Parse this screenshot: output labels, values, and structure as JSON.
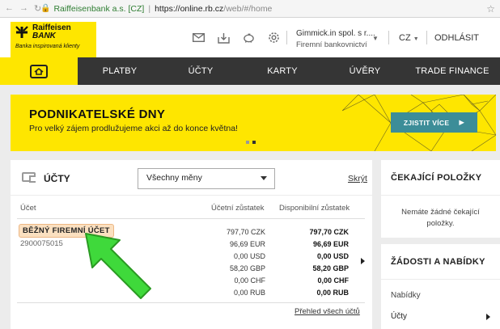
{
  "browser": {
    "site_identity": "Raiffeisenbank a.s. [CZ]",
    "url_host": "https://online.rb.cz",
    "url_path": "/web/#/home"
  },
  "header": {
    "logo_name_line1": "Raiffeisen",
    "logo_name_line2": "BANK",
    "logo_tagline": "Banka inspirovaná klienty",
    "company_name": "Gimmick.in spol. s r....",
    "company_type": "Firemní bankovnictví",
    "language": "CZ",
    "logout": "ODHLÁSIT"
  },
  "nav": {
    "items": [
      "PLATBY",
      "ÚČTY",
      "KARTY",
      "ÚVĚRY",
      "TRADE FINANCE"
    ]
  },
  "banner": {
    "title": "PODNIKATELSKÉ DNY",
    "text": "Pro velký zájem prodlužujeme akci až do konce května!",
    "button": "ZJISTIT VÍCE"
  },
  "accounts": {
    "title": "ÚČTY",
    "currency_filter": "Všechny měny",
    "hide_link": "Skrýt",
    "columns": {
      "account": "Účet",
      "book_balance": "Účetní zůstatek",
      "available_balance": "Disponibilní zůstatek"
    },
    "account": {
      "name": "BĚŽNÝ FIREMNÍ ÚČET",
      "number": "2900075015"
    },
    "balances": [
      {
        "book": "797,70 CZK",
        "available": "797,70 CZK"
      },
      {
        "book": "96,69 EUR",
        "available": "96,69 EUR"
      },
      {
        "book": "0,00 USD",
        "available": "0,00 USD"
      },
      {
        "book": "58,20 GBP",
        "available": "58,20 GBP"
      },
      {
        "book": "0,00 CHF",
        "available": "0,00 CHF"
      },
      {
        "book": "0,00 RUB",
        "available": "0,00 RUB"
      }
    ],
    "overview_link": "Přehled všech účtů"
  },
  "pending": {
    "title": "ČEKAJÍCÍ POLOŽKY",
    "note": "Nemáte žádné čekající položky."
  },
  "requests": {
    "title": "ŽÁDOSTI A NABÍDKY",
    "items": [
      "Nabídky",
      "Účty"
    ]
  },
  "colors": {
    "brand_yellow": "#fee600",
    "nav_dark": "#353535",
    "button_teal": "#3c8d98",
    "arrow_green": "#3fd93b"
  }
}
